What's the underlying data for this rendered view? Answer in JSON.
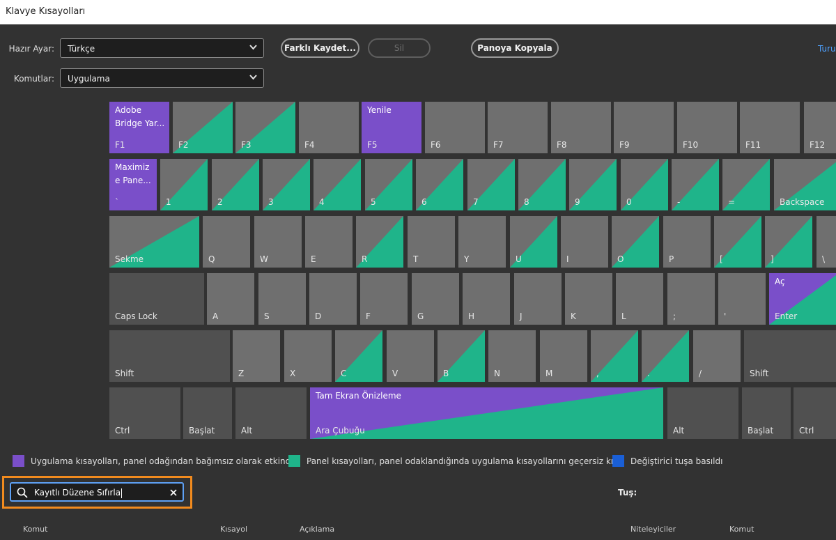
{
  "window": {
    "title": "Klavye Kısayolları"
  },
  "toolbar": {
    "preset_label": "Hazır Ayar:",
    "preset_value": "Türkçe",
    "commands_label": "Komutlar:",
    "commands_value": "Uygulama",
    "save_as_label": "Farklı Kaydet...",
    "delete_label": "Sil",
    "copy_label": "Panoya Kopyala",
    "tour_label": "Turu"
  },
  "colors": {
    "purple": "#7a4fc9",
    "teal": "#1fb48a",
    "blue": "#1a5fd6",
    "key": "#6f6f6f",
    "key_dark": "#505050"
  },
  "keyboard": {
    "rows": [
      [
        {
          "label": "F1",
          "type": "purple",
          "cmd": "Adobe\nBridge Yar..."
        },
        {
          "label": "F2",
          "type": "teal"
        },
        {
          "label": "F3",
          "type": "teal"
        },
        {
          "label": "F4",
          "type": "plain"
        },
        {
          "label": "F5",
          "type": "purple",
          "cmd": "Yenile"
        },
        {
          "label": "F6",
          "type": "plain"
        },
        {
          "label": "F7",
          "type": "plain"
        },
        {
          "label": "F8",
          "type": "plain"
        },
        {
          "label": "F9",
          "type": "plain"
        },
        {
          "label": "F10",
          "type": "plain"
        },
        {
          "label": "F11",
          "type": "plain"
        },
        {
          "label": "F12",
          "type": "plain"
        }
      ],
      [
        {
          "label": "`",
          "type": "purple",
          "cmd": "Maximiz\ne Pane..."
        },
        {
          "label": "1",
          "type": "teal"
        },
        {
          "label": "2",
          "type": "teal"
        },
        {
          "label": "3",
          "type": "teal"
        },
        {
          "label": "4",
          "type": "teal"
        },
        {
          "label": "5",
          "type": "teal"
        },
        {
          "label": "6",
          "type": "teal"
        },
        {
          "label": "7",
          "type": "teal"
        },
        {
          "label": "8",
          "type": "teal"
        },
        {
          "label": "9",
          "type": "teal"
        },
        {
          "label": "0",
          "type": "teal"
        },
        {
          "label": "-",
          "type": "teal"
        },
        {
          "label": "=",
          "type": "teal"
        },
        {
          "label": "Backspace",
          "type": "teal"
        }
      ],
      [
        {
          "label": "Sekme",
          "type": "teal"
        },
        {
          "label": "Q",
          "type": "plain"
        },
        {
          "label": "W",
          "type": "plain"
        },
        {
          "label": "E",
          "type": "plain"
        },
        {
          "label": "R",
          "type": "teal"
        },
        {
          "label": "T",
          "type": "plain"
        },
        {
          "label": "Y",
          "type": "plain"
        },
        {
          "label": "U",
          "type": "teal"
        },
        {
          "label": "I",
          "type": "plain"
        },
        {
          "label": "O",
          "type": "teal"
        },
        {
          "label": "P",
          "type": "plain"
        },
        {
          "label": "[",
          "type": "teal"
        },
        {
          "label": "]",
          "type": "teal"
        },
        {
          "label": "\\",
          "type": "plain"
        }
      ],
      [
        {
          "label": "Caps Lock",
          "type": "dark"
        },
        {
          "label": "A",
          "type": "plain"
        },
        {
          "label": "S",
          "type": "plain"
        },
        {
          "label": "D",
          "type": "plain"
        },
        {
          "label": "F",
          "type": "plain"
        },
        {
          "label": "G",
          "type": "plain"
        },
        {
          "label": "H",
          "type": "plain"
        },
        {
          "label": "J",
          "type": "plain"
        },
        {
          "label": "K",
          "type": "plain"
        },
        {
          "label": "L",
          "type": "plain"
        },
        {
          "label": ";",
          "type": "plain"
        },
        {
          "label": "'",
          "type": "plain"
        },
        {
          "label": "Enter",
          "type": "purple-teal",
          "cmd": "Aç"
        }
      ],
      [
        {
          "label": "Shift",
          "type": "dark"
        },
        {
          "label": "Z",
          "type": "plain"
        },
        {
          "label": "X",
          "type": "plain"
        },
        {
          "label": "C",
          "type": "teal"
        },
        {
          "label": "V",
          "type": "plain"
        },
        {
          "label": "B",
          "type": "teal"
        },
        {
          "label": "N",
          "type": "plain"
        },
        {
          "label": "M",
          "type": "plain"
        },
        {
          "label": ",",
          "type": "teal"
        },
        {
          "label": ".",
          "type": "teal"
        },
        {
          "label": "/",
          "type": "plain"
        },
        {
          "label": "Shift",
          "type": "dark"
        }
      ],
      [
        {
          "label": "Ctrl",
          "type": "dark"
        },
        {
          "label": "Başlat",
          "type": "dark"
        },
        {
          "label": "Alt",
          "type": "dark"
        },
        {
          "label": "Ara Çubuğu",
          "type": "purple-teal",
          "cmd": "Tam Ekran Önizleme"
        },
        {
          "label": "Alt",
          "type": "dark"
        },
        {
          "label": "Başlat",
          "type": "dark"
        },
        {
          "label": "Ctrl",
          "type": "dark"
        }
      ]
    ]
  },
  "legend": {
    "app": "Uygulama kısayolları, panel odağından bağımsız olarak etkindir",
    "panel": "Panel kısayolları, panel odaklandığında uygulama kısayollarını geçersiz kılar",
    "modifier": "Değiştirici tuşa basıldı"
  },
  "search": {
    "value": "Kayıtlı Düzene Sıfırla"
  },
  "key_label": "Tuş:",
  "table_left": {
    "headers": [
      "Komut",
      "Kısayol",
      "Açıklama"
    ]
  },
  "table_right": {
    "headers": [
      "Niteleyiciler",
      "Komut"
    ]
  }
}
